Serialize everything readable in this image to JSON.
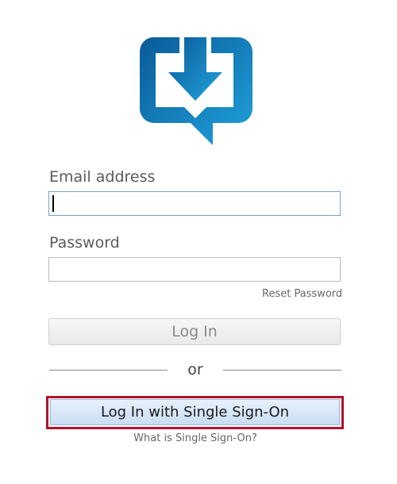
{
  "logo": {
    "icon": "download-chat-bubble-icon",
    "colors": [
      "#0a5f9e",
      "#1c9ad6"
    ]
  },
  "email": {
    "label": "Email address",
    "value": "",
    "placeholder": ""
  },
  "password": {
    "label": "Password",
    "value": "",
    "placeholder": ""
  },
  "reset_password_label": "Reset Password",
  "login_button_label": "Log In",
  "divider_text": "or",
  "sso_button_label": "Log In with Single Sign-On",
  "sso_help_link": "What is Single Sign-On?",
  "colors": {
    "sso_highlight": "#b0122c",
    "sso_button": "#c9ddf3"
  }
}
